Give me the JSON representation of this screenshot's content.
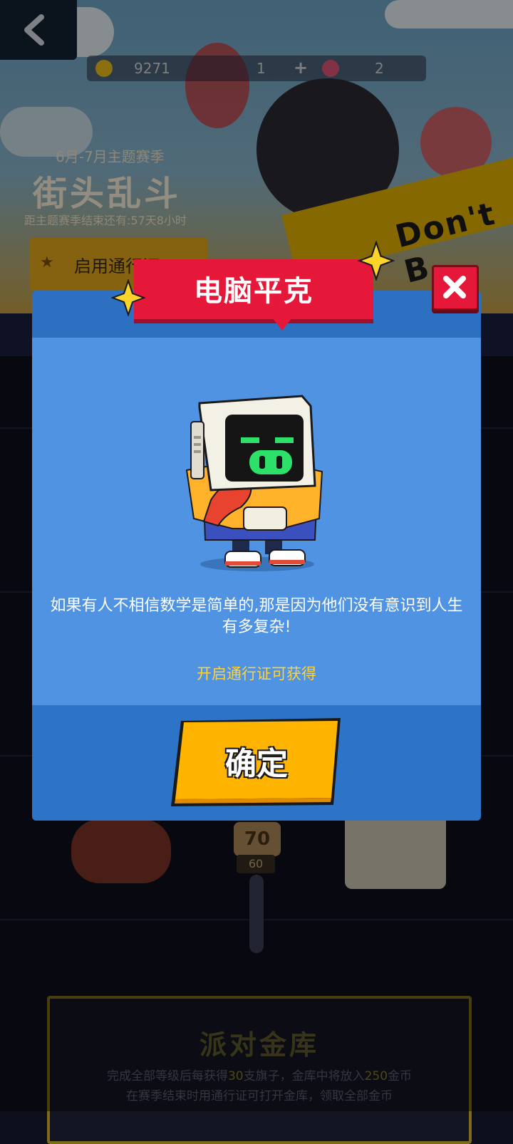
{
  "background": {
    "currency": {
      "coins": "9271",
      "gems": "1",
      "tickets": "2"
    },
    "season": {
      "subtitle": "6月-7月主题赛季",
      "title": "街头乱斗",
      "time_left": "距主题赛季结束还有:57天8小时"
    },
    "pass_button_label": "启用通行证",
    "sign_text": "Don't B",
    "level": {
      "number": "70",
      "flags": "60"
    },
    "vault": {
      "title": "派对金库",
      "line1_a": "完成全部等级后每获得",
      "line1_b": "30",
      "line1_c": "支旗子，金库中将放入",
      "line1_d": "250",
      "line1_e": "金币",
      "line2": "在赛季结束时用通行证可打开金库，领取全部金币"
    }
  },
  "modal": {
    "title": "电脑平克",
    "quote": "如果有人不相信数学是简单的,那是因为他们没有意识到人生有多复杂!",
    "pass_hint": "开启通行证可获得",
    "confirm_label": "确定",
    "close_icon": "close-icon"
  },
  "colors": {
    "modal_body": "#4f93e2",
    "ribbon": "#e5183a",
    "confirm": "#ffb400",
    "hint": "#ffd23c"
  }
}
